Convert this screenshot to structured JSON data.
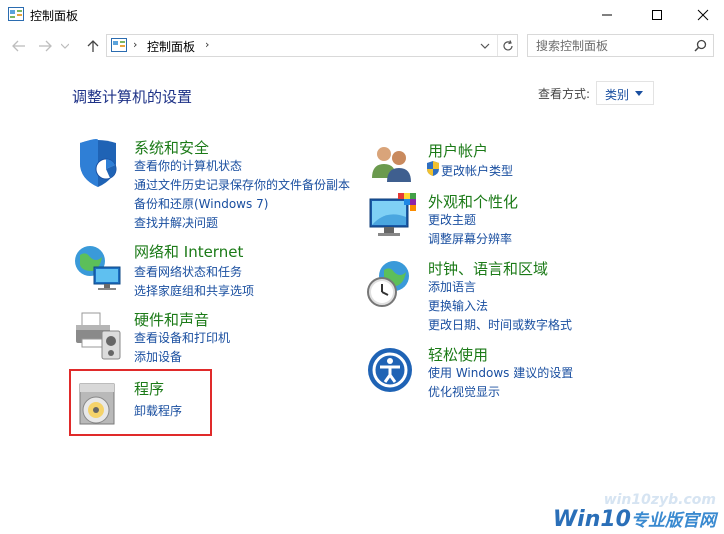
{
  "window": {
    "title": "控制面板"
  },
  "nav": {
    "breadcrumb": "控制面板",
    "search_placeholder": "搜索控制面板"
  },
  "main": {
    "heading": "调整计算机的设置",
    "view_by_label": "查看方式:",
    "view_by_value": "类别"
  },
  "categories": {
    "security": {
      "title": "系统和安全",
      "links": [
        "查看你的计算机状态",
        "通过文件历史记录保存你的文件备份副本",
        "备份和还原(Windows 7)",
        "查找并解决问题"
      ]
    },
    "network": {
      "title": "网络和 Internet",
      "links": [
        "查看网络状态和任务",
        "选择家庭组和共享选项"
      ]
    },
    "hardware": {
      "title": "硬件和声音",
      "links": [
        "查看设备和打印机",
        "添加设备"
      ]
    },
    "programs": {
      "title": "程序",
      "links": [
        "卸载程序"
      ]
    },
    "accounts": {
      "title": "用户帐户",
      "links": [
        "更改帐户类型"
      ]
    },
    "appearance": {
      "title": "外观和个性化",
      "links": [
        "更改主题",
        "调整屏幕分辨率"
      ]
    },
    "clock": {
      "title": "时钟、语言和区域",
      "links": [
        "添加语言",
        "更换输入法",
        "更改日期、时间或数字格式"
      ]
    },
    "ease": {
      "title": "轻松使用",
      "links": [
        "使用 Windows 建议的设置",
        "优化视觉显示"
      ]
    }
  },
  "watermark": {
    "url": "win10zyb.com",
    "brand": "Win10",
    "brand_sub": "专业版官网"
  },
  "colors": {
    "title_green": "#1b7a17",
    "link_blue": "#1a4fa0",
    "heading_blue": "#1e3287",
    "highlight_red": "#e02a2a"
  }
}
